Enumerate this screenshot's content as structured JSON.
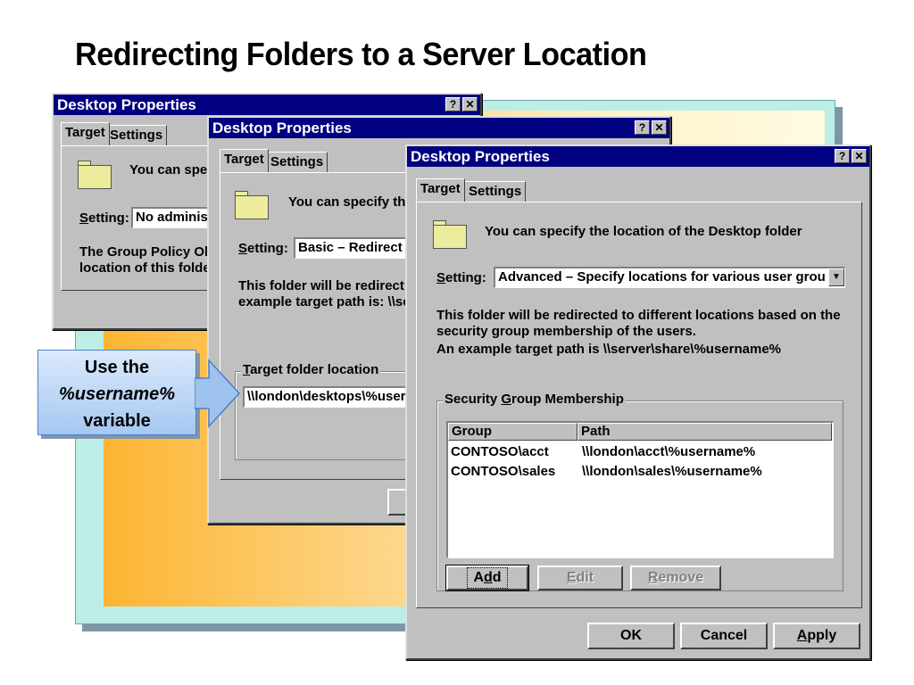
{
  "slide": {
    "title": "Redirecting Folders to a Server Location"
  },
  "callout": {
    "line1": "Use the",
    "line2": "%username%",
    "line3": "variable"
  },
  "dialog_back": {
    "title": "Desktop Properties",
    "help_btn": "?",
    "close_btn": "✕",
    "tab_target": "Target",
    "tab_settings": "Settings",
    "description": "You can spec",
    "setting_label_accel": "S",
    "setting_label_rest": "etting:",
    "setting_value": "No adminis",
    "info_line1": "The Group Policy Ol",
    "info_line2": "location of this folde"
  },
  "dialog_mid": {
    "title": "Desktop Properties",
    "help_btn": "?",
    "close_btn": "✕",
    "tab_target": "Target",
    "tab_settings": "Settings",
    "description": "You can specify th",
    "setting_label_accel": "S",
    "setting_label_rest": "etting:",
    "setting_value": "Basic – Redirect",
    "info_line1": "This folder will be redirect",
    "info_line2": "example target path is: \\\\se",
    "target_group_accel": "T",
    "target_group_rest": "arget folder location",
    "target_path": "\\\\london\\desktops\\%user"
  },
  "dialog_front": {
    "title": "Desktop Properties",
    "help_btn": "?",
    "close_btn": "✕",
    "tab_target": "Target",
    "tab_settings": "Settings",
    "description": "You can specify the location of the Desktop folder",
    "setting_label_accel": "S",
    "setting_label_rest": "etting:",
    "setting_value": "Advanced – Specify locations for various user grou",
    "dropdown_arrow": "▼",
    "info_line1": "This folder will be redirected to different locations based on the",
    "info_line2": "security group membership of the users.",
    "info_line3": "An example target path is \\\\server\\share\\%username%",
    "group_legend_pre": "Security ",
    "group_legend_accel": "G",
    "group_legend_post": "roup Membership",
    "columns": [
      "Group",
      "Path"
    ],
    "rows": [
      {
        "group": "CONTOSO\\acct",
        "path": "\\\\london\\acct\\%username%"
      },
      {
        "group": "CONTOSO\\sales",
        "path": "\\\\london\\sales\\%username%"
      }
    ],
    "add_pre": "A",
    "add_accel": "d",
    "add_post": "d",
    "edit_accel": "E",
    "edit_rest": "dit",
    "remove_accel": "R",
    "remove_rest": "emove",
    "ok_label": "OK",
    "cancel_label": "Cancel",
    "apply_accel": "A",
    "apply_rest": "pply"
  },
  "colors": {
    "titlebar": "#000080",
    "dialog_face": "#c0c0c0",
    "callout_fill": "#a5c8f2",
    "callout_arrow": "#9fc3ef",
    "frame": "#bdeee6"
  },
  "icons": [
    "folder-icon",
    "help-icon",
    "close-icon",
    "dropdown-arrow-icon",
    "callout-arrow-icon"
  ]
}
